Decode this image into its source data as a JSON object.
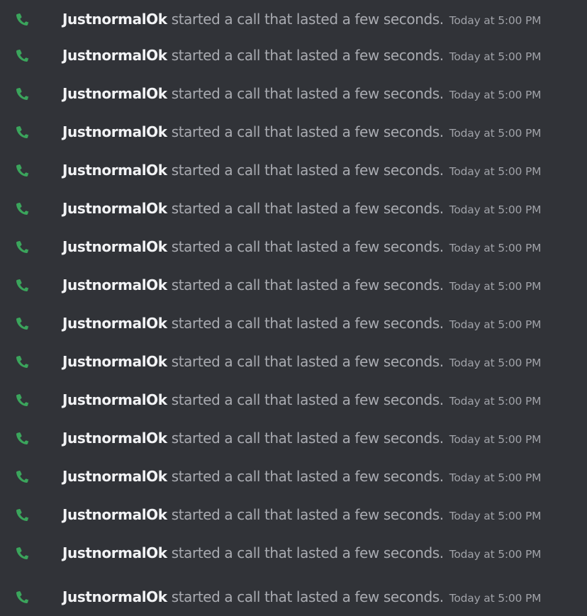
{
  "colors": {
    "background": "#313338",
    "author": "#f2f3f5",
    "message": "#a9abb1",
    "timestamp": "#a0a2a8",
    "call_icon": "#3ba55c"
  },
  "messages": [
    {
      "icon": "phone-icon",
      "author": "JustnormalOk",
      "text": "started a call that lasted a few seconds.",
      "timestamp": "Today at 5:00 PM"
    },
    {
      "icon": "phone-icon",
      "author": "JustnormalOk",
      "text": "started a call that lasted a few seconds.",
      "timestamp": "Today at 5:00 PM"
    },
    {
      "icon": "phone-icon",
      "author": "JustnormalOk",
      "text": "started a call that lasted a few seconds.",
      "timestamp": "Today at 5:00 PM"
    },
    {
      "icon": "phone-icon",
      "author": "JustnormalOk",
      "text": "started a call that lasted a few seconds.",
      "timestamp": "Today at 5:00 PM"
    },
    {
      "icon": "phone-icon",
      "author": "JustnormalOk",
      "text": "started a call that lasted a few seconds.",
      "timestamp": "Today at 5:00 PM"
    },
    {
      "icon": "phone-icon",
      "author": "JustnormalOk",
      "text": "started a call that lasted a few seconds.",
      "timestamp": "Today at 5:00 PM"
    },
    {
      "icon": "phone-icon",
      "author": "JustnormalOk",
      "text": "started a call that lasted a few seconds.",
      "timestamp": "Today at 5:00 PM"
    },
    {
      "icon": "phone-icon",
      "author": "JustnormalOk",
      "text": "started a call that lasted a few seconds.",
      "timestamp": "Today at 5:00 PM"
    },
    {
      "icon": "phone-icon",
      "author": "JustnormalOk",
      "text": "started a call that lasted a few seconds.",
      "timestamp": "Today at 5:00 PM"
    },
    {
      "icon": "phone-icon",
      "author": "JustnormalOk",
      "text": "started a call that lasted a few seconds.",
      "timestamp": "Today at 5:00 PM"
    },
    {
      "icon": "phone-icon",
      "author": "JustnormalOk",
      "text": "started a call that lasted a few seconds.",
      "timestamp": "Today at 5:00 PM"
    },
    {
      "icon": "phone-icon",
      "author": "JustnormalOk",
      "text": "started a call that lasted a few seconds.",
      "timestamp": "Today at 5:00 PM"
    },
    {
      "icon": "phone-icon",
      "author": "JustnormalOk",
      "text": "started a call that lasted a few seconds.",
      "timestamp": "Today at 5:00 PM"
    },
    {
      "icon": "phone-icon",
      "author": "JustnormalOk",
      "text": "started a call that lasted a few seconds.",
      "timestamp": "Today at 5:00 PM"
    },
    {
      "icon": "phone-icon",
      "author": "JustnormalOk",
      "text": "started a call that lasted a few seconds.",
      "timestamp": "Today at 5:00 PM"
    },
    {
      "icon": "phone-icon",
      "author": "JustnormalOk",
      "text": "started a call that lasted a few seconds.",
      "timestamp": "Today at 5:00 PM"
    }
  ]
}
